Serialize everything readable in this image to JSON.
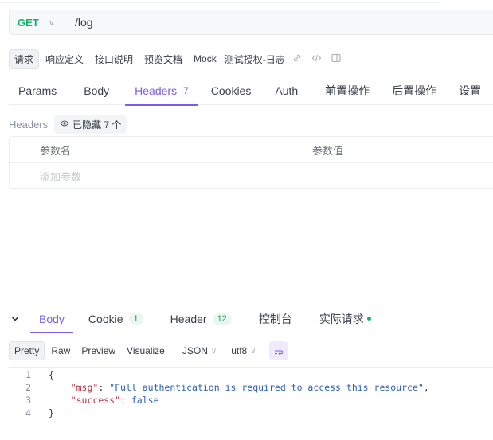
{
  "request": {
    "method": "GET",
    "url": "/log"
  },
  "subtoolbar": {
    "items": [
      "请求",
      "响应定义",
      "接口说明",
      "预览文档",
      "Mock",
      "测试授权-日志"
    ]
  },
  "request_tabs": [
    {
      "label": "Params"
    },
    {
      "label": "Body"
    },
    {
      "label": "Headers",
      "count": "7"
    },
    {
      "label": "Cookies"
    },
    {
      "label": "Auth"
    },
    {
      "label": "前置操作"
    },
    {
      "label": "后置操作"
    },
    {
      "label": "设置"
    }
  ],
  "headers_section": {
    "label": "Headers",
    "hidden_label": "已隐藏 7 个"
  },
  "params_table": {
    "col_name": "参数名",
    "col_value": "参数值",
    "add_placeholder": "添加参数"
  },
  "response_tabs": [
    {
      "label": "Body"
    },
    {
      "label": "Cookie",
      "count": "1"
    },
    {
      "label": "Header",
      "count": "12"
    },
    {
      "label": "控制台"
    },
    {
      "label": "实际请求"
    }
  ],
  "format_bar": {
    "modes": [
      "Pretty",
      "Raw",
      "Preview",
      "Visualize"
    ],
    "type": "JSON",
    "encoding": "utf8"
  },
  "response_body": {
    "line_numbers": [
      "1",
      "2",
      "3",
      "4"
    ],
    "open_brace": "{",
    "msg_key": "\"msg\"",
    "msg_value": "\"Full authentication is required to access this resource\"",
    "success_key": "\"success\"",
    "success_value": "false",
    "close_brace": "}"
  },
  "colors": {
    "accent": "#7b5cf0",
    "method_get": "#17b26a"
  }
}
